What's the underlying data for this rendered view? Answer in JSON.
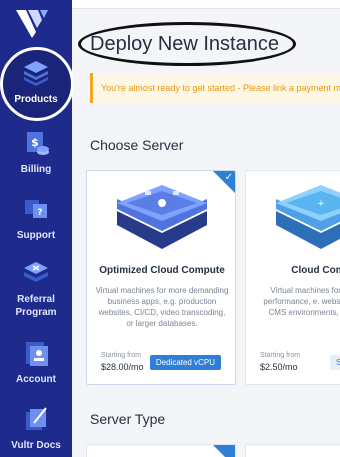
{
  "sidebar": {
    "items": [
      {
        "label": "Products",
        "icon": "layers-icon"
      },
      {
        "label": "Billing",
        "icon": "billing-icon"
      },
      {
        "label": "Support",
        "icon": "support-icon"
      },
      {
        "label": "Referral Program",
        "label_lines": [
          "Referral",
          "Program"
        ],
        "icon": "referral-icon"
      },
      {
        "label": "Account",
        "icon": "account-icon"
      },
      {
        "label": "Vultr Docs",
        "icon": "docs-icon"
      }
    ]
  },
  "header": {
    "title": "Deploy New Instance",
    "alert": "You're almost ready to get started - Please link a payment metho"
  },
  "sections": {
    "choose_server": "Choose Server",
    "server_type": "Server Type"
  },
  "cards": [
    {
      "name": "Optimized Cloud Compute",
      "description": "Virtual machines for more demanding business apps, e.g. production websites, CI/CD, video transcoding, or larger databases.",
      "starting_label": "Starting from",
      "price": "$28.00/mo",
      "button": "Dedicated vCPU",
      "selected": true
    },
    {
      "name": "Cloud Comp",
      "description": "Virtual machines for a bursty performance, e. websites, blogs, CMS environments, and smal",
      "starting_label": "Starting from",
      "price": "$2.50/mo",
      "button": "Sh",
      "selected": false
    }
  ],
  "colors": {
    "sidebar": "#1e2a8c",
    "accent": "#2f7fd8",
    "alert": "#f5a623"
  }
}
